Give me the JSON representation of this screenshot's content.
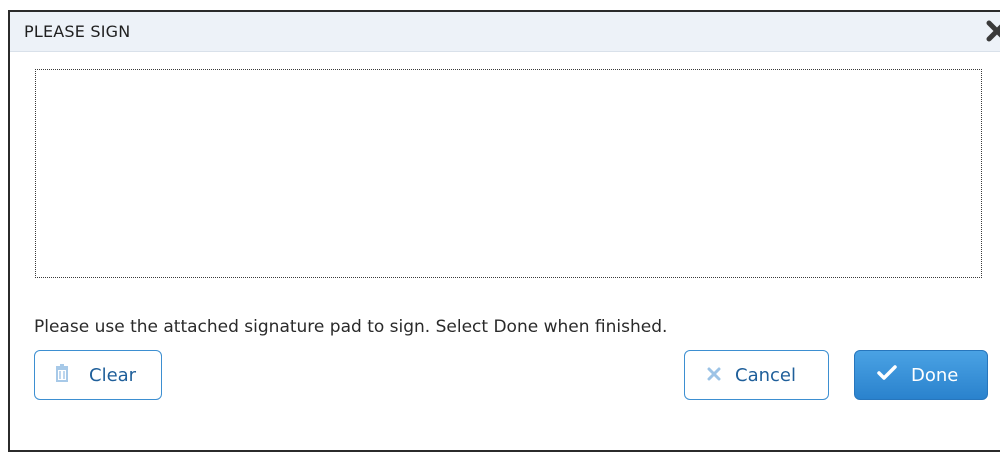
{
  "dialog": {
    "title": "PLEASE SIGN",
    "instruction": "Please use the attached signature pad to sign. Select Done when finished.",
    "buttons": {
      "clear": "Clear",
      "cancel": "Cancel",
      "done": "Done"
    }
  },
  "icons": {
    "close": "close-icon",
    "clear": "trash-icon",
    "cancel": "x-icon",
    "done": "checkmark-icon"
  },
  "colors": {
    "titlebar_bg": "#edf2f8",
    "accent": "#3d8fd1",
    "primary_button": "#2a82cd"
  }
}
